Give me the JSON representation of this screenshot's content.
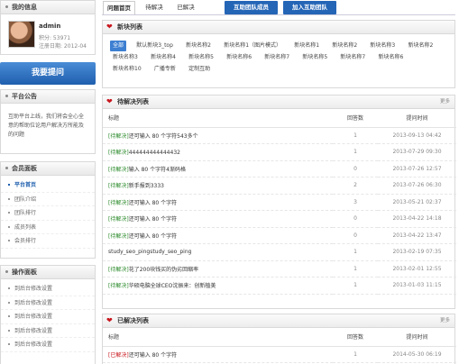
{
  "my_info": {
    "title": "我的信息",
    "username": "admin",
    "points": "积分: 53971",
    "registered": "注册日期: 2012-04"
  },
  "ask_button": "我要提问",
  "notice": {
    "title": "平台公告",
    "text": "互助平台上线，我们将会全心全意的帮助位论用户解决方所能及的问题"
  },
  "member_panel": {
    "title": "会员面板",
    "items": [
      "平台首页",
      "团队介绍",
      "团队排行",
      "成员列表",
      "会员排行"
    ]
  },
  "ops_panel": {
    "title": "操作面板",
    "items": [
      "到后台修改设置",
      "到后台修改设置",
      "到后台修改设置",
      "到后台修改设置",
      "到后台修改设置"
    ]
  },
  "tabs": [
    "问题首页",
    "待解决",
    "已解决",
    "互助团队成员",
    "加入互助团队"
  ],
  "categories": {
    "title": "新块列表",
    "items": [
      "全部",
      "默认新块3_top",
      "新块名称2",
      "新块名称1（图片模式）",
      "新块名称1",
      "新块名称2",
      "新块名称3",
      "新块名称2",
      "新块名称3",
      "新块名称4",
      "新块名称5",
      "新块名称6",
      "新块名称7",
      "新块名称5",
      "新块名称7",
      "新块名称6",
      "新块名称10",
      "广播专新",
      "定制互助"
    ]
  },
  "pending": {
    "title": "待解决列表",
    "more": "更多",
    "headers": [
      "标题",
      "回答数",
      "提问时间"
    ],
    "rows": [
      {
        "status": "[待解决]",
        "title": "还可输入 80 个字符543多个",
        "answers": "1",
        "time": "2013-09-13 04:42"
      },
      {
        "status": "[待解决]",
        "title": "444444444444432",
        "answers": "1",
        "time": "2013-07-29 09:30"
      },
      {
        "status": "[待解决]",
        "title": "输入 80 个字符4渐码格",
        "answers": "0",
        "time": "2013-07-26 12:57"
      },
      {
        "status": "[待解决]",
        "title": "新手报到3333",
        "answers": "2",
        "time": "2013-07-26 06:30"
      },
      {
        "status": "[待解决]",
        "title": "还可输入 80 个字符",
        "answers": "3",
        "time": "2013-05-21 02:37"
      },
      {
        "status": "[待解决]",
        "title": "还可输入 80 个字符",
        "answers": "0",
        "time": "2013-04-22 14:18"
      },
      {
        "status": "[待解决]",
        "title": "还可输入 80 个字符",
        "answers": "0",
        "time": "2013-04-22 13:47"
      },
      {
        "status": "",
        "title": "study_seo_pingstudy_seo_ping",
        "answers": "1",
        "time": "2013-02-19 07:35"
      },
      {
        "status": "[待解决]",
        "title": "花了200块钱买的伪劣回缩率",
        "answers": "1",
        "time": "2013-02-01 12:55"
      },
      {
        "status": "[待解决]",
        "title": "华硕电脑全球CEO沈振来：创新植美",
        "answers": "1",
        "time": "2013-01-03 11:15"
      }
    ]
  },
  "solved": {
    "title": "已解决列表",
    "more": "更多",
    "headers": [
      "标题",
      "回答数",
      "提问时间"
    ],
    "rows": [
      {
        "status": "[已解决]",
        "title": "还可输入 80 个字符",
        "answers": "1",
        "time": "2014-05-30 06:19"
      }
    ]
  },
  "colors": {
    "brand_blue": "#2465b6",
    "heart_red": "#c8161d",
    "pending_green": "#2a8a2a"
  }
}
